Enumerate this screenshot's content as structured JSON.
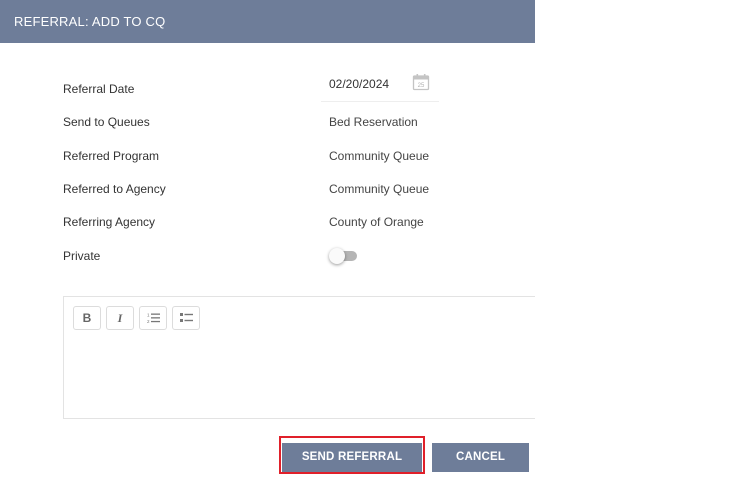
{
  "header": {
    "title": "REFERRAL: ADD TO CQ"
  },
  "form": {
    "referral_date": {
      "label": "Referral Date",
      "value": "02/20/2024"
    },
    "send_to_queues": {
      "label": "Send to Queues",
      "value": "Bed Reservation"
    },
    "referred_program": {
      "label": "Referred Program",
      "value": "Community Queue"
    },
    "referred_to_agency": {
      "label": "Referred to Agency",
      "value": "Community Queue"
    },
    "referring_agency": {
      "label": "Referring Agency",
      "value": "County of Orange"
    },
    "private": {
      "label": "Private",
      "value": "off"
    }
  },
  "calendar_icon": {
    "name": "calendar-icon",
    "day": "25"
  },
  "editor": {
    "toolbar": {
      "bold": "B",
      "italic": "I",
      "ordered_list_icon": "ordered-list-icon",
      "unordered_list_icon": "unordered-list-icon"
    }
  },
  "actions": {
    "send_label": "SEND REFERRAL",
    "cancel_label": "CANCEL"
  },
  "colors": {
    "accent": "#6e7d99",
    "highlight": "#e0202a"
  }
}
